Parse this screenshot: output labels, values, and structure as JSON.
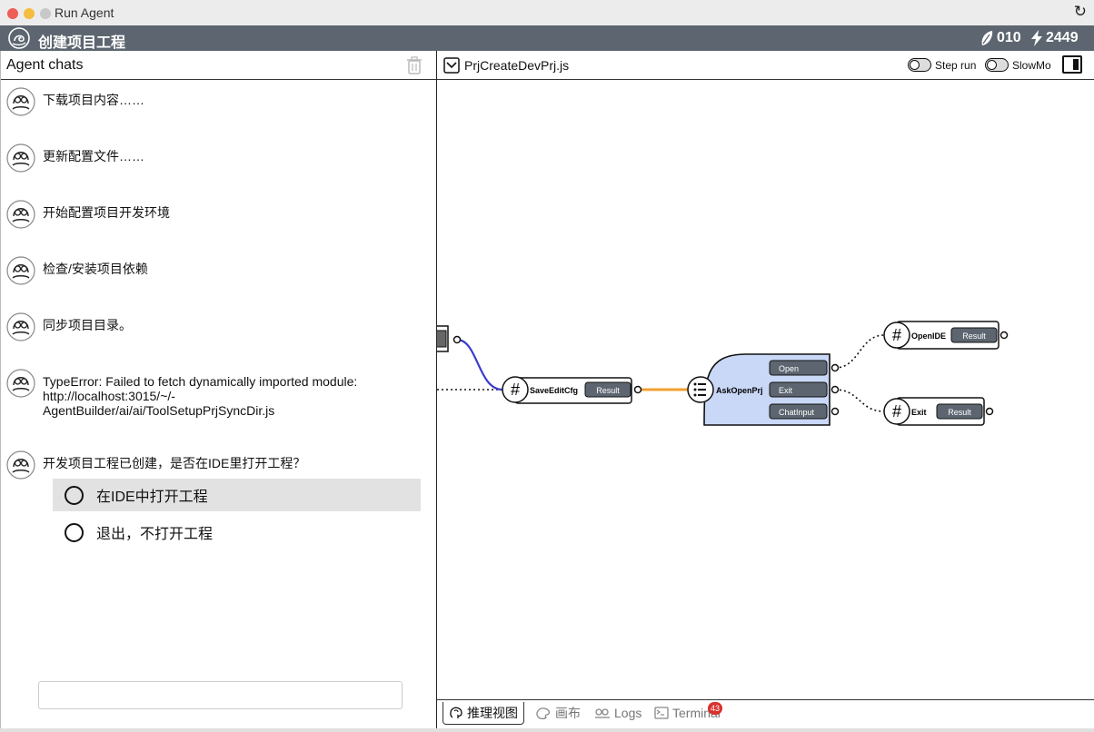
{
  "window": {
    "title": "Run Agent"
  },
  "header": {
    "title": "创建项目工程",
    "stat_a": "010",
    "stat_b": "2449"
  },
  "chats": {
    "title": "Agent chats",
    "messages": [
      "下载项目内容……",
      "更新配置文件……",
      "开始配置项目开发环境",
      "检查/安装项目依赖",
      "同步项目目录。",
      "TypeError: Failed to fetch dynamically imported module:\nhttp://localhost:3015/~/-\nAgentBuilder/ai/ai/ToolSetupPrjSyncDir.js",
      "开发项目工程已创建，是否在IDE里打开工程？"
    ],
    "options": [
      "在IDE中打开工程",
      "退出，不打开工程"
    ],
    "input_placeholder": ""
  },
  "editor": {
    "file": "PrjCreateDevPrj.js",
    "step_run": "Step run",
    "slowmo": "SlowMo"
  },
  "graph": {
    "nodes": {
      "save": {
        "label": "SaveEditCfg",
        "port": "Result"
      },
      "ask": {
        "label": "AskOpenPrj",
        "ports": [
          "Open",
          "Exit",
          "ChatInput"
        ]
      },
      "open_ide": {
        "label": "OpenIDE",
        "port": "Result"
      },
      "exit": {
        "label": "Exit",
        "port": "Result"
      }
    }
  },
  "tabs": [
    {
      "label": "推理视图"
    },
    {
      "label": "画布"
    },
    {
      "label": "Logs"
    },
    {
      "label": "Terminal",
      "badge": "43"
    }
  ],
  "colors": {
    "header": "#5d6670",
    "ask_node": "#c9d8f7",
    "orange_link": "#f0a030",
    "blue_link": "#3b3bd0",
    "badge": "#d9312b"
  }
}
